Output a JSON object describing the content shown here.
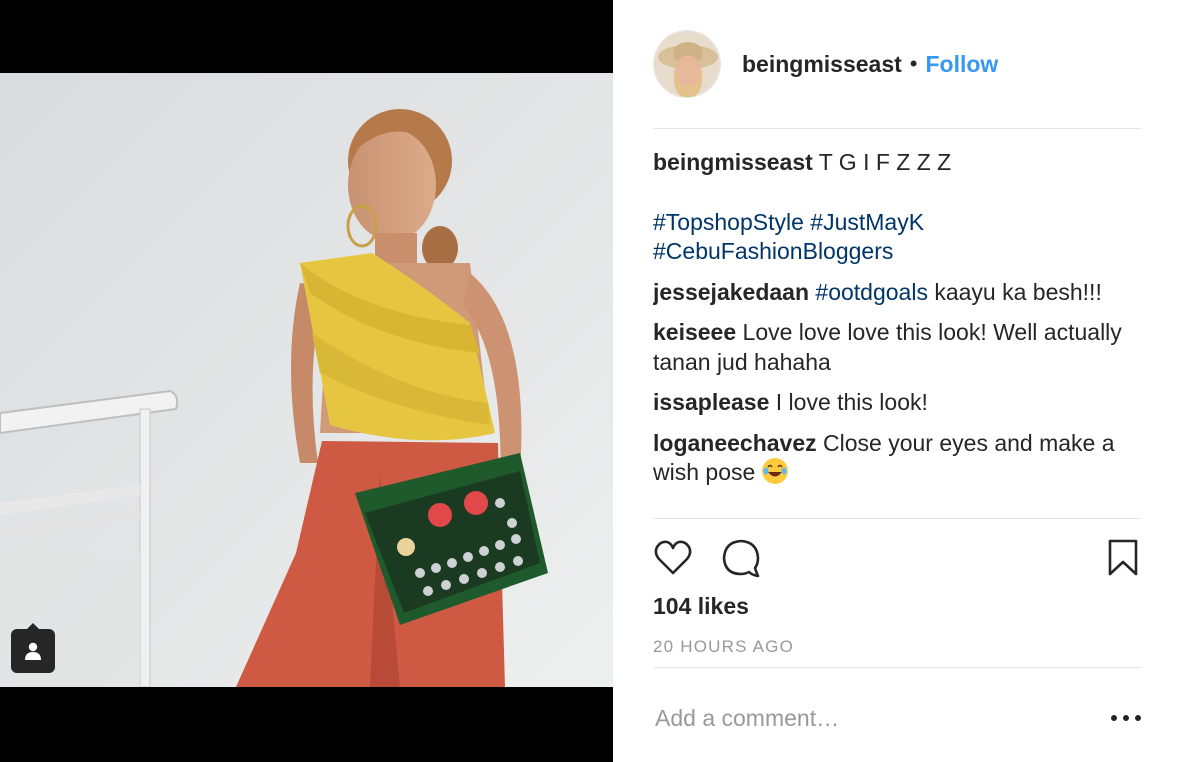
{
  "post": {
    "username": "beingmisseast",
    "follow_label": "Follow",
    "separator": "•"
  },
  "caption": {
    "user": "beingmisseast",
    "text": "T G I F Z Z Z",
    "hashtags_line1": "#TopshopStyle #JustMayK",
    "hashtags_line2": "#CebuFashionBloggers"
  },
  "comments": [
    {
      "user": "jessejakedaan",
      "tag": "#ootdgoals",
      "text": "kaayu ka besh!!!"
    },
    {
      "user": "keiseee",
      "text": "Love love love this look! Well actually tanan jud hahaha"
    },
    {
      "user": "issaplease",
      "text": "I love this look!"
    },
    {
      "user": "loganeechavez",
      "text": "Close your eyes and make a wish pose"
    }
  ],
  "stats": {
    "likes": "104 likes",
    "time": "20 HOURS AGO"
  },
  "composer": {
    "placeholder": "Add a comment…"
  },
  "icons": {
    "like": "heart-icon",
    "comment": "speech-bubble-icon",
    "save": "bookmark-icon",
    "more": "more-options-icon",
    "tagged_people": "person-tag-icon",
    "emoji": "laughing-tears-emoji"
  },
  "colors": {
    "link": "#3897f0",
    "hashtag": "#003569",
    "muted": "#999999",
    "text": "#262626"
  }
}
